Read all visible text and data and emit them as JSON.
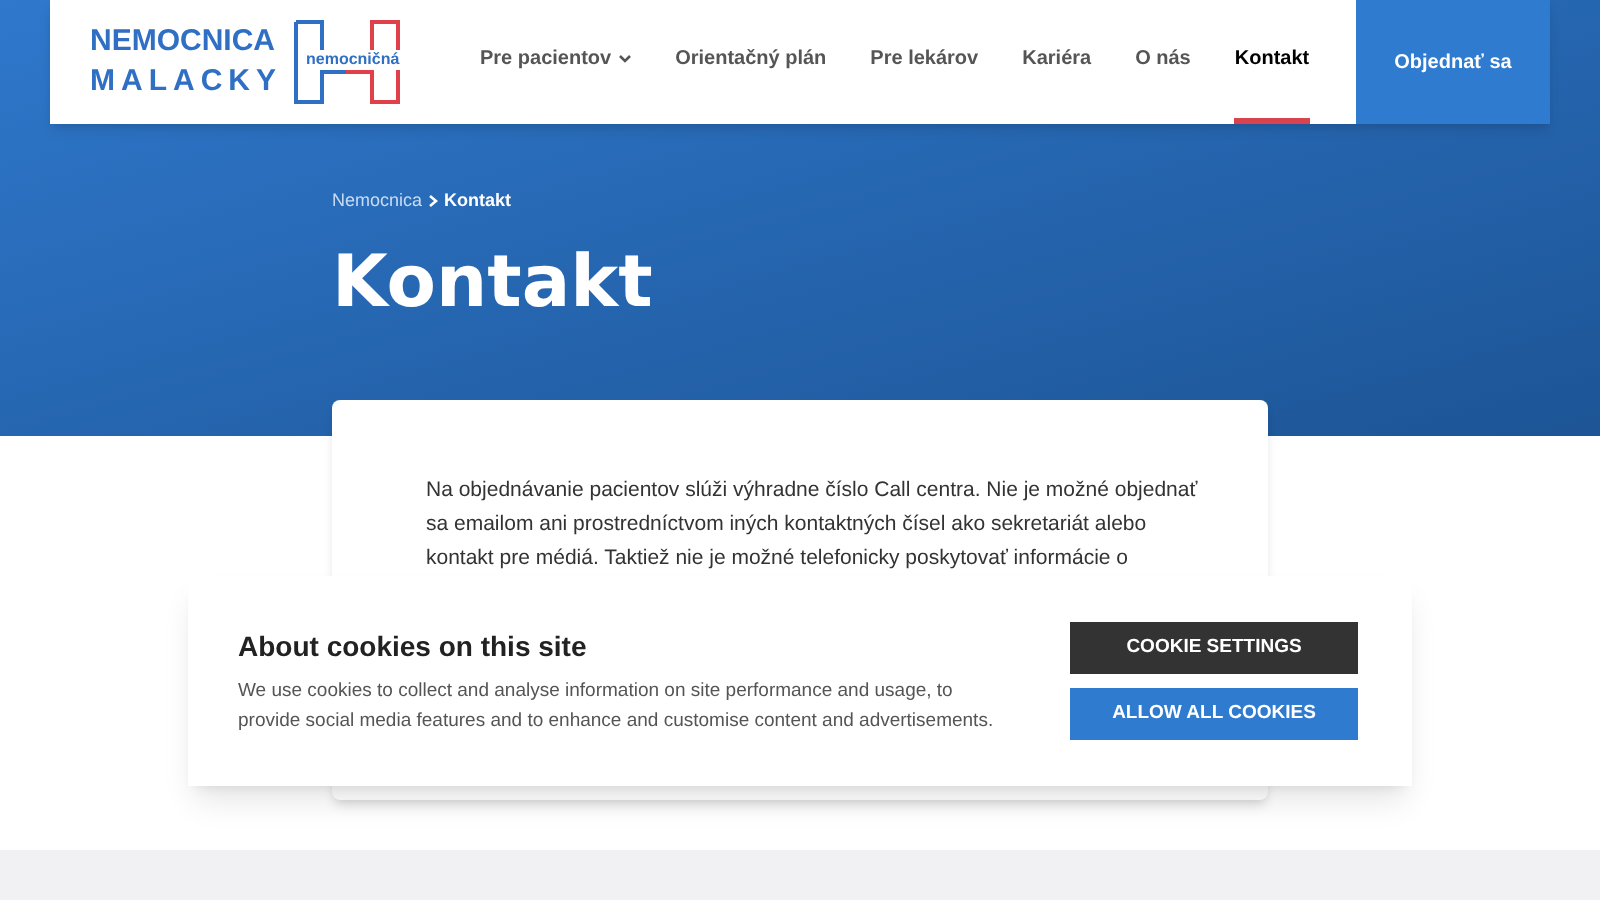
{
  "logo": {
    "line_1": "NEMOCNICA",
    "line_2": "MALACKY",
    "mark_text": "nemocničná"
  },
  "nav": [
    {
      "label": "Pre pacientov",
      "kind": "dropdown",
      "selected": false
    },
    {
      "label": "Orientačný plán",
      "kind": "link",
      "selected": false
    },
    {
      "label": "Pre lekárov",
      "kind": "link",
      "selected": false
    },
    {
      "label": "Kariéra",
      "kind": "link",
      "selected": false
    },
    {
      "label": "O nás",
      "kind": "link",
      "selected": false
    },
    {
      "label": "Kontakt",
      "kind": "link",
      "selected": true
    }
  ],
  "cta": "Objednať sa",
  "breadcrumb": [
    "Nemocnica",
    "Kontakt"
  ],
  "title": "Kontakt",
  "paragraph": "Na objednávanie pacientov slúži výhradne číslo Call centra. Nie je možné objednať sa emailom ani prostredníctvom iných kontaktných čísel ako sekretariát alebo kontakt pre médiá. Taktiež nie je možné telefonicky poskytovať informácie o",
  "cookies": {
    "title": "About cookies on this site",
    "text": "We use cookies to collect and analyse information on site performance and usage, to provide social media features and to enhance and customise content and advertisements.",
    "buttons": [
      {
        "label": "COOKIE SETTINGS",
        "kind": "secondary"
      },
      {
        "label": "ALLOW ALL COOKIES",
        "kind": "primary"
      }
    ]
  }
}
